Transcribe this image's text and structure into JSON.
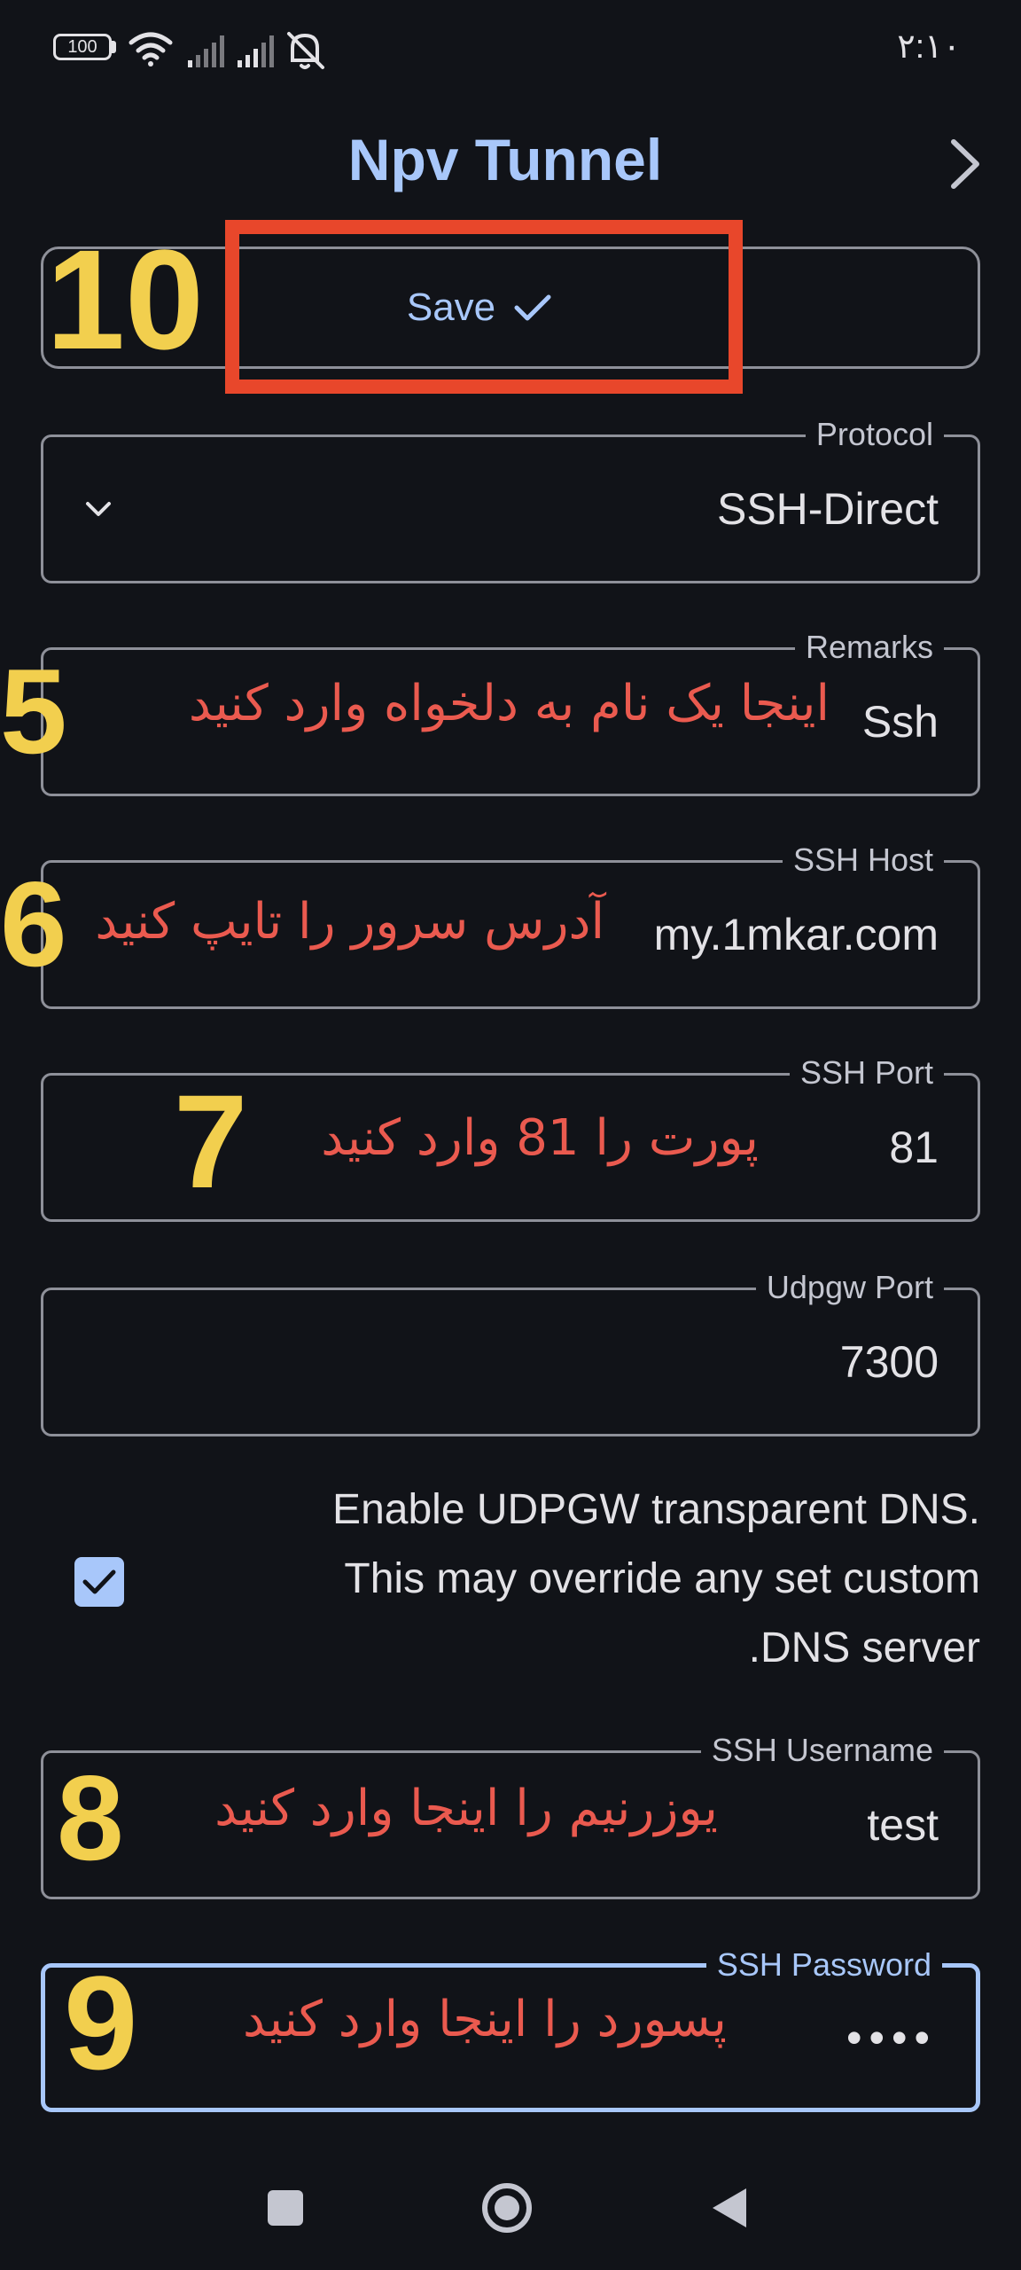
{
  "status_bar": {
    "time": "۲:۱۰",
    "battery": "100"
  },
  "header": {
    "title": "Npv Tunnel"
  },
  "save_button": {
    "label": "Save"
  },
  "fields": {
    "protocol": {
      "label": "Protocol",
      "value": "SSH-Direct"
    },
    "remarks": {
      "label": "Remarks",
      "value": "Ssh"
    },
    "ssh_host": {
      "label": "SSH Host",
      "value": "my.1mkar.com"
    },
    "ssh_port": {
      "label": "SSH Port",
      "value": "81"
    },
    "udpgw_port": {
      "label": "Udpgw Port",
      "value": "7300"
    },
    "ssh_username": {
      "label": "SSH Username",
      "value": "test"
    },
    "ssh_password": {
      "label": "SSH Password",
      "value": "••••"
    }
  },
  "udpgw_dns": {
    "line1": "Enable UDPGW transparent DNS.",
    "line2": "This may override any set custom",
    "line3": ".DNS server",
    "checked": true
  },
  "annotations": {
    "n10": "10",
    "n5": "5",
    "t5": "اینجا یک نام به دلخواه وارد کنید",
    "n6": "6",
    "t6": "آدرس سرور را تایپ کنید",
    "n7": "7",
    "t7": "پورت را 81 وارد کنید",
    "n8": "8",
    "t8": "یوزرنیم را اینجا وارد کنید",
    "n9": "9",
    "t9": "پسورد را اینجا وارد کنید"
  },
  "colors": {
    "background": "#111318",
    "accent": "#a8c7fa",
    "outline": "#8e9099",
    "annotation_number": "#f2cf4e",
    "annotation_text": "#ea5a4f",
    "highlight_box": "#e8472b"
  },
  "icons": {
    "next": "chevron-right-icon",
    "save": "check-icon",
    "dropdown": "chevron-down-icon",
    "nav_recents": "square-icon",
    "nav_home": "circle-icon",
    "nav_back": "triangle-back-icon"
  }
}
